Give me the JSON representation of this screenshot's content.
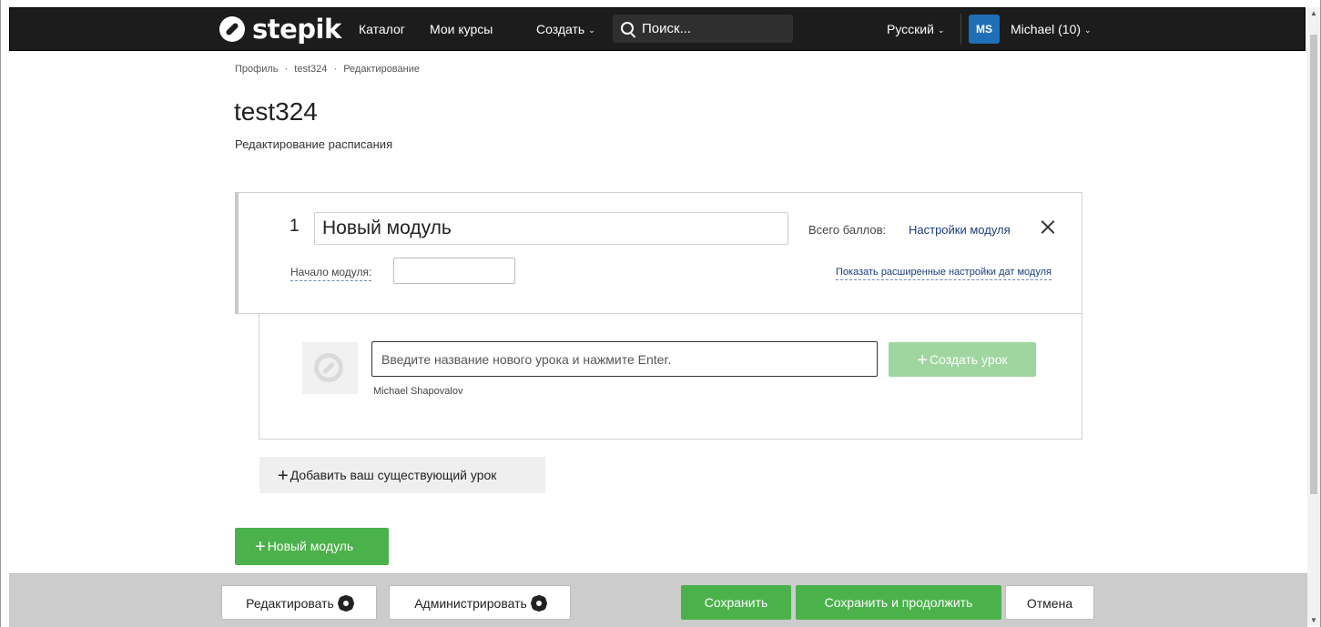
{
  "nav": {
    "logo_text": "stepik",
    "catalog": "Каталог",
    "my_courses": "Мои курсы",
    "create": "Создать",
    "search_placeholder": "Поиск...",
    "language": "Русский",
    "avatar_initials": "MS",
    "user_label": "Michael (10)"
  },
  "breadcrumb": [
    "Профиль",
    "·",
    "test324",
    "·",
    "Редактирование"
  ],
  "page": {
    "title": "test324",
    "subtitle": "Редактирование расписания"
  },
  "module": {
    "number": "1",
    "title_value": "Новый модуль",
    "total_points_label": "Всего баллов:",
    "settings_link": "Настройки модуля",
    "start_label": "Начало модуля:",
    "start_value": "",
    "advanced_link": "Показать расширенные настройки дат модуля"
  },
  "lesson": {
    "input_placeholder": "Введите название нового урока и нажмите Enter.",
    "author": "Michael Shapovalov",
    "create_button": "Создать урок"
  },
  "actions": {
    "add_existing": "Добавить ваш существующий урок",
    "new_module": "Новый модуль"
  },
  "toolbar": {
    "edit": "Редактировать",
    "administer": "Администрировать",
    "save": "Сохранить",
    "save_continue": "Сохранить и продолжить",
    "cancel": "Отмена"
  },
  "colors": {
    "nav_bg": "#1c1c1c",
    "primary_green": "#4bb24b",
    "disabled_green": "#9fd69f",
    "link_blue": "#1a3d7c",
    "avatar_blue": "#1f6fb6",
    "toolbar_bg": "#cccccc"
  },
  "icons": {
    "logo": "stepik-logo-icon",
    "search": "search-icon",
    "caret": "chevron-down-icon",
    "close": "close-icon",
    "plus": "plus-icon",
    "gear": "gear-icon"
  }
}
